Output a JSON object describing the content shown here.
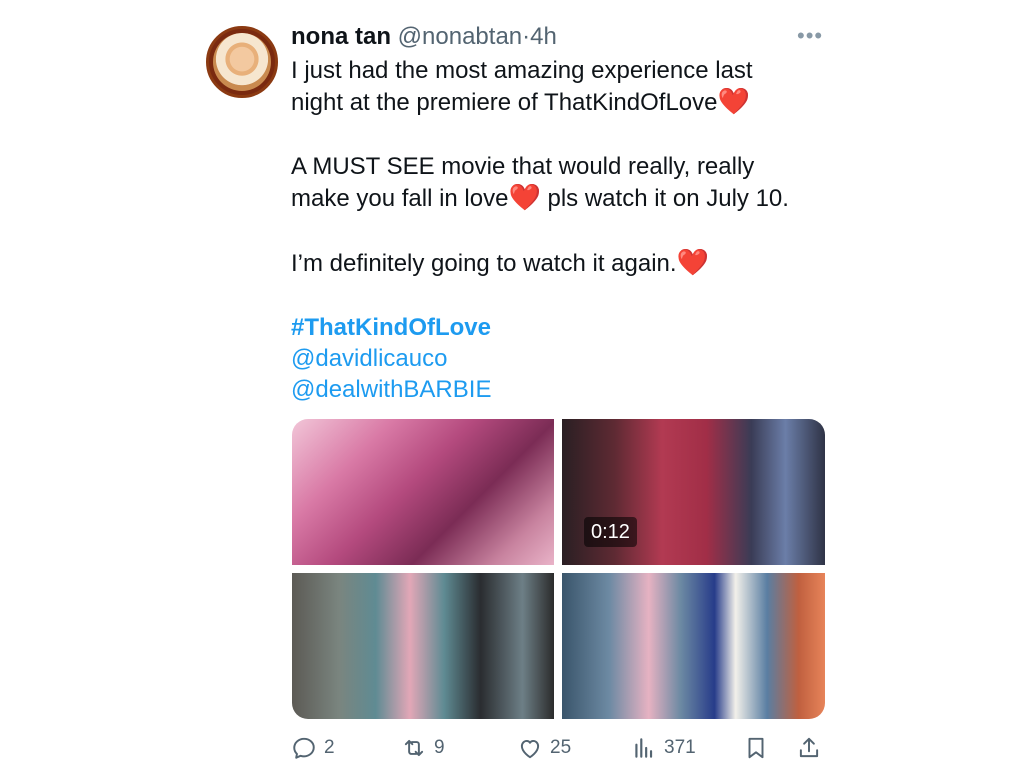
{
  "tweet": {
    "display_name": "nona tan",
    "handle": "@nonabtan",
    "separator": "·",
    "time": "4h",
    "more_icon": "more-dots-icon",
    "text": {
      "line1": "I just had the most amazing experience last",
      "line2_prefix": "night at the premiere of ThatKindOfLove",
      "heart": "❤️",
      "line3": "A MUST SEE movie that would really, really",
      "line4_prefix": "make you fall in love",
      "line4_suffix": " pls watch it on July 10.",
      "line5_prefix": "I’m definitely going to watch it again.",
      "hashtag": "#ThatKindOfLove",
      "mention1": "@davidlicauco",
      "mention2": "@dealwithBARBIE"
    },
    "media": {
      "video_duration": "0:12"
    },
    "actions": {
      "replies": "2",
      "retweets": "9",
      "likes": "25",
      "views": "371"
    },
    "colors": {
      "link": "#1d9bf0",
      "muted": "#536471",
      "heart": "#e0245e"
    }
  }
}
